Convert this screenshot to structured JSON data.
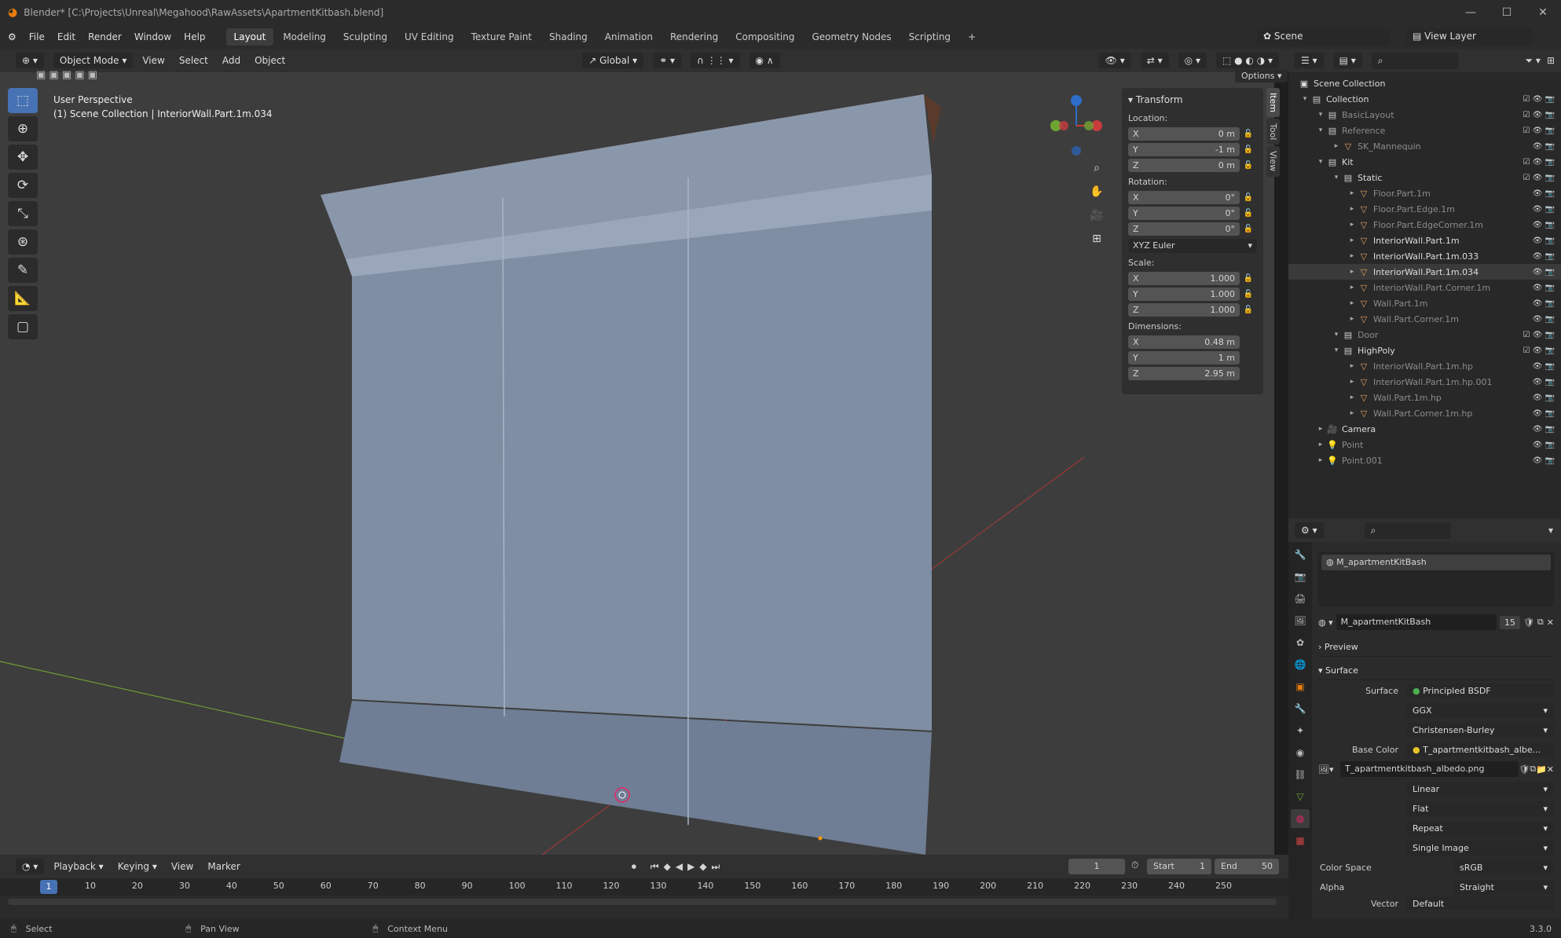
{
  "window": {
    "title": "Blender* [C:\\Projects\\Unreal\\Megahood\\RawAssets\\ApartmentKitbash.blend]"
  },
  "menu": [
    "File",
    "Edit",
    "Render",
    "Window",
    "Help"
  ],
  "workspaces": [
    "Layout",
    "Modeling",
    "Sculpting",
    "UV Editing",
    "Texture Paint",
    "Shading",
    "Animation",
    "Rendering",
    "Compositing",
    "Geometry Nodes",
    "Scripting"
  ],
  "scene": "Scene",
  "view_layer": "View Layer",
  "viewport_header": {
    "mode": "Object Mode",
    "menus": [
      "View",
      "Select",
      "Add",
      "Object"
    ],
    "transform_orientation": "Global",
    "options": "Options"
  },
  "viewport": {
    "perspective": "User Perspective",
    "collection_info": "(1) Scene Collection | InteriorWall.Part.1m.034"
  },
  "transform": {
    "title": "Transform",
    "location_label": "Location:",
    "location": [
      {
        "axis": "X",
        "value": "0 m"
      },
      {
        "axis": "Y",
        "value": "-1 m"
      },
      {
        "axis": "Z",
        "value": "0 m"
      }
    ],
    "rotation_label": "Rotation:",
    "rotation": [
      {
        "axis": "X",
        "value": "0°"
      },
      {
        "axis": "Y",
        "value": "0°"
      },
      {
        "axis": "Z",
        "value": "0°"
      }
    ],
    "rotation_mode": "XYZ Euler",
    "scale_label": "Scale:",
    "scale": [
      {
        "axis": "X",
        "value": "1.000"
      },
      {
        "axis": "Y",
        "value": "1.000"
      },
      {
        "axis": "Z",
        "value": "1.000"
      }
    ],
    "dimensions_label": "Dimensions:",
    "dimensions": [
      {
        "axis": "X",
        "value": "0.48 m"
      },
      {
        "axis": "Y",
        "value": "1 m"
      },
      {
        "axis": "Z",
        "value": "2.95 m"
      }
    ]
  },
  "sidebar_tabs": [
    "Item",
    "Tool",
    "View"
  ],
  "outliner": {
    "root": "Scene Collection",
    "rows": [
      {
        "label": "Collection",
        "depth": 0,
        "type": "collection",
        "dim": false
      },
      {
        "label": "BasicLayout",
        "depth": 1,
        "type": "collection",
        "dim": true
      },
      {
        "label": "Reference",
        "depth": 1,
        "type": "collection",
        "dim": true
      },
      {
        "label": "SK_Mannequin",
        "depth": 2,
        "type": "mesh",
        "dim": true
      },
      {
        "label": "Kit",
        "depth": 1,
        "type": "collection",
        "dim": false
      },
      {
        "label": "Static",
        "depth": 2,
        "type": "collection",
        "dim": false
      },
      {
        "label": "Floor.Part.1m",
        "depth": 3,
        "type": "mesh",
        "dim": true
      },
      {
        "label": "Floor.Part.Edge.1m",
        "depth": 3,
        "type": "mesh",
        "dim": true
      },
      {
        "label": "Floor.Part.EdgeCorner.1m",
        "depth": 3,
        "type": "mesh",
        "dim": true
      },
      {
        "label": "InteriorWall.Part.1m",
        "depth": 3,
        "type": "mesh",
        "dim": false
      },
      {
        "label": "InteriorWall.Part.1m.033",
        "depth": 3,
        "type": "mesh",
        "dim": false
      },
      {
        "label": "InteriorWall.Part.1m.034",
        "depth": 3,
        "type": "mesh",
        "dim": false
      },
      {
        "label": "InteriorWall.Part.Corner.1m",
        "depth": 3,
        "type": "mesh",
        "dim": true
      },
      {
        "label": "Wall.Part.1m",
        "depth": 3,
        "type": "mesh",
        "dim": true
      },
      {
        "label": "Wall.Part.Corner.1m",
        "depth": 3,
        "type": "mesh",
        "dim": true
      },
      {
        "label": "Door",
        "depth": 2,
        "type": "collection",
        "dim": true
      },
      {
        "label": "HighPoly",
        "depth": 2,
        "type": "collection",
        "dim": false
      },
      {
        "label": "InteriorWall.Part.1m.hp",
        "depth": 3,
        "type": "mesh",
        "dim": true
      },
      {
        "label": "InteriorWall.Part.1m.hp.001",
        "depth": 3,
        "type": "mesh",
        "dim": true
      },
      {
        "label": "Wall.Part.1m.hp",
        "depth": 3,
        "type": "mesh",
        "dim": true
      },
      {
        "label": "Wall.Part.Corner.1m.hp",
        "depth": 3,
        "type": "mesh",
        "dim": true
      },
      {
        "label": "Camera",
        "depth": 1,
        "type": "camera",
        "dim": false
      },
      {
        "label": "Point",
        "depth": 1,
        "type": "light",
        "dim": true
      },
      {
        "label": "Point.001",
        "depth": 1,
        "type": "light",
        "dim": true
      }
    ]
  },
  "properties": {
    "material_slot": "M_apartmentKitBash",
    "material_name": "M_apartmentKitBash",
    "users": "15",
    "preview": "Preview",
    "surface_section": "Surface",
    "rows": [
      {
        "label": "Surface",
        "value": "Principled BSDF",
        "dot": "#4caf50"
      },
      {
        "label": "",
        "value": "GGX",
        "dot": ""
      },
      {
        "label": "",
        "value": "Christensen-Burley",
        "dot": ""
      },
      {
        "label": "Base Color",
        "value": "T_apartmentkitbash_albe...",
        "dot": "#e6c229"
      }
    ],
    "image": "T_apartmentkitbash_albedo.png",
    "image_rows": [
      "Linear",
      "Flat",
      "Repeat",
      "Single Image"
    ],
    "color_space_label": "Color Space",
    "color_space": "sRGB",
    "alpha_label": "Alpha",
    "alpha": "Straight",
    "vector_label": "Vector",
    "vector": "Default"
  },
  "timeline": {
    "menus": [
      "Playback",
      "Keying",
      "View",
      "Marker"
    ],
    "current_frame": "1",
    "start_label": "Start",
    "start": "1",
    "end_label": "End",
    "end": "50",
    "ticks": [
      "1",
      "10",
      "20",
      "30",
      "40",
      "50",
      "60",
      "70",
      "80",
      "90",
      "100",
      "110",
      "120",
      "130",
      "140",
      "150",
      "160",
      "170",
      "180",
      "190",
      "200",
      "210",
      "220",
      "230",
      "240",
      "250"
    ]
  },
  "status": {
    "select": "Select",
    "pan": "Pan View",
    "context": "Context Menu",
    "version": "3.3.0"
  },
  "colors": {
    "accent": "#4772b3",
    "header": "#303030",
    "viewport": "#3d3d3d",
    "blender_orange": "#e87d0d"
  }
}
